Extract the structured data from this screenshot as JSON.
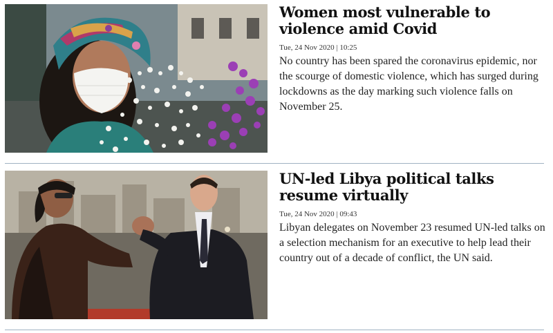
{
  "articles": [
    {
      "headline": "Women most vulnerable to violence amid Covid",
      "meta": "Tue, 24 Nov 2020 | 10:25",
      "summary": "No country has been spared the coronavirus epidemic, nor the scourge of domestic violence, which has surged during lockdowns as the day marking such violence falls on November 25."
    },
    {
      "headline": "UN-led Libya political talks resume virtually",
      "meta": "Tue, 24 Nov 2020 | 09:43",
      "summary": "Libyan delegates on November 23 resumed UN-led talks on a selection mechanism for an executive to help lead their country out of a decade of conflict, the UN said."
    }
  ]
}
